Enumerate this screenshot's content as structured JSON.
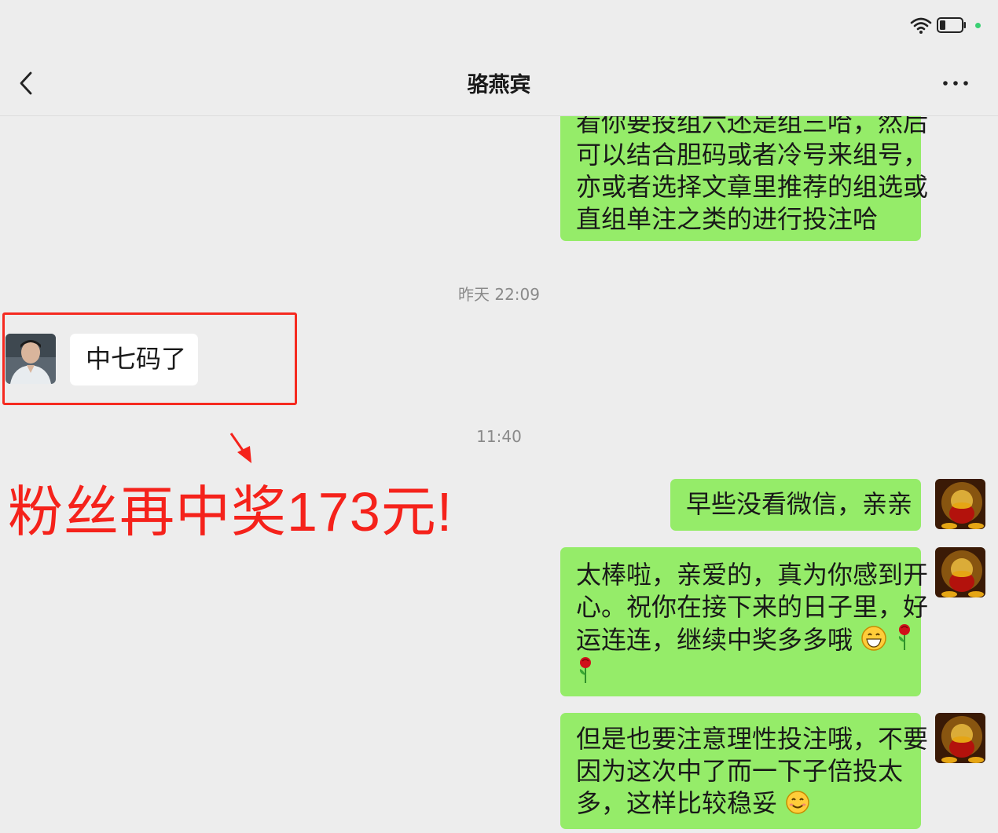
{
  "status_bar": {
    "icons": [
      "wifi-icon",
      "battery-icon",
      "dot-icon"
    ]
  },
  "nav": {
    "title": "骆燕宾",
    "back_icon": "back-icon",
    "more_icon": "more-icon"
  },
  "messages": {
    "m1": {
      "sender": "me",
      "lines": [
        "看你要投组六还是组三哈，然后",
        "可以结合胆码或者冷号来组号，",
        "亦或者选择文章里推荐的组选或",
        "直组单注之类的进行投注哈"
      ]
    },
    "t1": "昨天 22:09",
    "m2": {
      "sender": "them",
      "lines": [
        "中七码了"
      ]
    },
    "t2": "11:40",
    "m3": {
      "sender": "me",
      "lines": [
        "早些没看微信，亲亲"
      ]
    },
    "m4": {
      "sender": "me",
      "lines": [
        "太棒啦，亲爱的，真为你感到开",
        "心。祝你在接下来的日子里，好",
        "运连连，继续中奖多多哦",
        ""
      ]
    },
    "m5": {
      "sender": "me",
      "lines": [
        "但是也要注意理性投注哦，不要",
        "因为这次中了而一下子倍投太",
        "多，这样比较稳妥"
      ]
    }
  },
  "annotation": {
    "text": "粉丝再中奖173元!"
  },
  "colors": {
    "my_bubble": "#95ec69",
    "their_bubble": "#ffffff",
    "annotation_red": "#f5221b",
    "background": "#ededed"
  }
}
